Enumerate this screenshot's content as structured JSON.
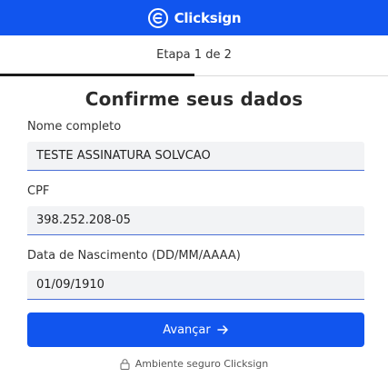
{
  "header": {
    "brand": "Clicksign",
    "icon": "clicksign-logo-icon",
    "color": "#1155ee"
  },
  "steps": {
    "label": "Etapa 1 de 2",
    "progress": 0.5
  },
  "form": {
    "title": "Confirme seus dados",
    "fields": [
      {
        "label": "Nome completo",
        "value": "TESTE ASSINATURA SOLVCAO"
      },
      {
        "label": "CPF",
        "value": "398.252.208-05"
      },
      {
        "label": "Data de Nascimento (DD/MM/AAAA)",
        "value": "01/09/1910"
      }
    ],
    "submit_label": "Avançar",
    "submit_icon": "arrow-right-icon"
  },
  "footer": {
    "secure_text": "Ambiente seguro Clicksign",
    "icon": "lock-icon"
  }
}
